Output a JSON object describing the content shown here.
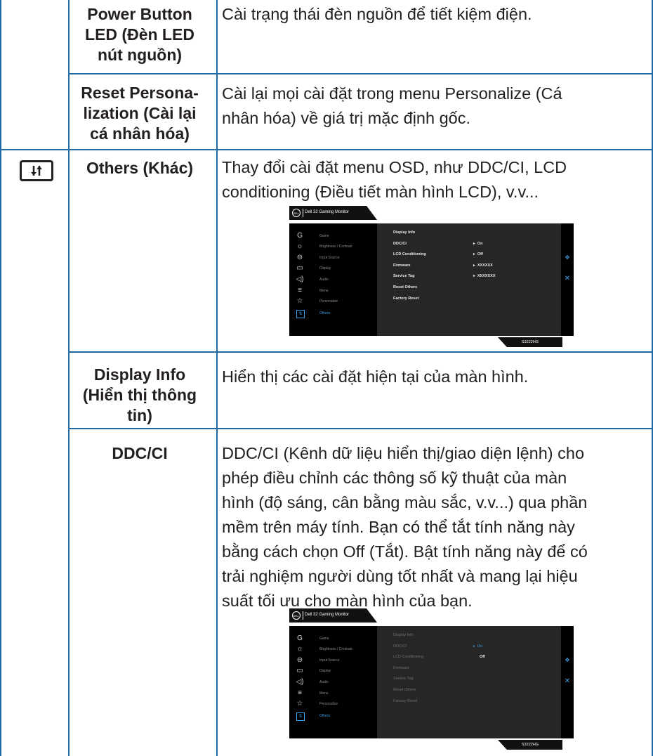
{
  "rows": [
    {
      "name": [
        "Power Button",
        "LED (Đèn LED",
        "nút nguồn)"
      ],
      "desc": [
        "Cài trạng thái đèn nguồn để tiết kiệm điện."
      ]
    },
    {
      "name": [
        "Reset Persona-",
        "lization (Cài lại",
        "cá nhân hóa)"
      ],
      "desc": [
        "Cài lại mọi cài đặt trong menu Personalize (Cá",
        "nhân hóa) về giá trị mặc định gốc."
      ]
    },
    {
      "name": [
        "Others (Khác)"
      ],
      "desc": [
        "Thay đổi cài đặt menu OSD, như DDC/CI, LCD",
        "conditioning (Điều tiết màn hình LCD), v.v..."
      ],
      "icon": "others-icon"
    },
    {
      "name": [
        "Display Info",
        "(Hiển thị thông",
        "tin)"
      ],
      "desc": [
        "Hiển thị các cài đặt hiện tại của màn hình."
      ]
    },
    {
      "name": [
        "DDC/CI"
      ],
      "desc": [
        "DDC/CI (Kênh dữ liệu hiển thị/giao diện lệnh) cho",
        "phép điều chỉnh các thông số kỹ thuật của màn",
        "hình (độ sáng, cân bằng màu sắc, v.v...) qua phần",
        "mềm trên máy tính. Bạn có thể tắt tính năng này",
        "bằng cách chọn Off (Tắt). Bật tính năng này để có",
        "trải nghiệm người dùng tốt nhất và mang lại hiệu",
        "suất tối ưu cho màn hình của bạn."
      ]
    }
  ],
  "osd": {
    "brand": "DELL",
    "title": "Dell 32 Gaming Monitor",
    "model": "S3222HG",
    "menu": [
      "Game",
      "Brightness / Contrast",
      "Input Source",
      "Display",
      "Audio",
      "Menu",
      "Personalize",
      "Others"
    ],
    "menu_icons": [
      "game-icon",
      "brightness-icon",
      "input-source-icon",
      "display-icon",
      "audio-icon",
      "menu-icon",
      "personalize-icon",
      "others-icon"
    ],
    "items": [
      "Display Info",
      "DDC/CI",
      "LCD Conditioning",
      "Firmware",
      "Service Tag",
      "Reset Others",
      "Factory Reset"
    ],
    "values1": [
      "",
      "On",
      "Off",
      "XXXXXX",
      "XXXXXXX",
      "",
      ""
    ],
    "values2": [
      "On",
      "Off"
    ]
  }
}
